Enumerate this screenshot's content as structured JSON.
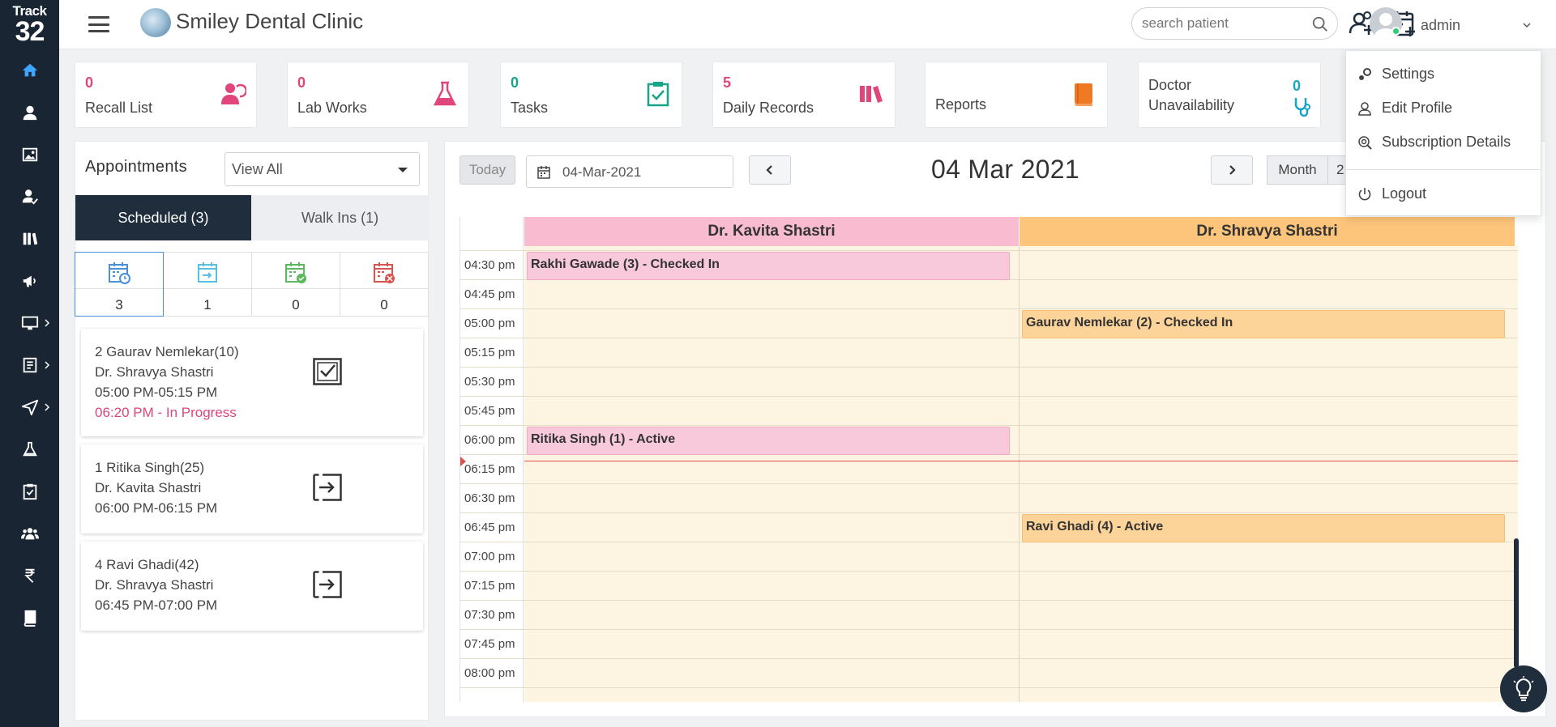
{
  "sidebar": {
    "logo_line1": "Track",
    "logo_line2": "32",
    "items": [
      {
        "icon": "home-icon"
      },
      {
        "icon": "patient-icon"
      },
      {
        "icon": "image-icon"
      },
      {
        "icon": "user-check-icon"
      },
      {
        "icon": "library-icon"
      },
      {
        "icon": "megaphone-icon"
      },
      {
        "icon": "monitor-icon",
        "has_sub": true
      },
      {
        "icon": "document-icon",
        "has_sub": true
      },
      {
        "icon": "send-icon",
        "has_sub": true
      },
      {
        "icon": "flask-icon"
      },
      {
        "icon": "clipboard-check-icon"
      },
      {
        "icon": "group-icon"
      },
      {
        "icon": "rupee-icon"
      },
      {
        "icon": "book-icon"
      }
    ]
  },
  "header": {
    "clinic_name": "Smiley Dental Clinic",
    "search_placeholder": "search patient",
    "username": "admin"
  },
  "cards": [
    {
      "count": "0",
      "label": "Recall List",
      "color": "#e0457b",
      "icon": "recall-icon"
    },
    {
      "count": "0",
      "label": "Lab Works",
      "color": "#e0457b",
      "icon": "flask-icon"
    },
    {
      "count": "0",
      "label": "Tasks",
      "color": "#17a589",
      "icon": "clipboard-check-icon"
    },
    {
      "count": "5",
      "label": "Daily Records",
      "color": "#e0457b",
      "icon": "books-icon"
    },
    {
      "label": "Reports",
      "color": "#f07a24",
      "icon": "report-book-icon"
    },
    {
      "count": "0",
      "label_line1": "Doctor",
      "label_line2": "Unavailability",
      "color": "#17a5c4",
      "icon": "stethoscope-icon"
    }
  ],
  "appointments": {
    "title": "Appointments",
    "filter_value": "View All",
    "tab_scheduled": "Scheduled (3)",
    "tab_walkins": "Walk Ins (1)",
    "stats": [
      {
        "icon": "calendar-clock-icon",
        "value": "3",
        "color": "#4a90d9"
      },
      {
        "icon": "calendar-arrow-icon",
        "value": "1",
        "color": "#5bc0de"
      },
      {
        "icon": "calendar-check-icon",
        "value": "0",
        "color": "#5cb85c"
      },
      {
        "icon": "calendar-cancel-icon",
        "value": "0",
        "color": "#d9534f"
      }
    ],
    "list": [
      {
        "name": "2 Gaurav Nemlekar(10)",
        "doctor": "Dr. Shravya Shastri",
        "time": "05:00 PM-05:15 PM",
        "status": "06:20 PM - In Progress",
        "icon": "checkbox-icon"
      },
      {
        "name": "1 Ritika Singh(25)",
        "doctor": "Dr. Kavita Shastri",
        "time": "06:00 PM-06:15 PM",
        "icon": "check-in-icon"
      },
      {
        "name": "4 Ravi Ghadi(42)",
        "doctor": "Dr. Shravya Shastri",
        "time": "06:45 PM-07:00 PM",
        "icon": "check-in-icon"
      }
    ]
  },
  "calendar": {
    "today_label": "Today",
    "date_value": "04-Mar-2021",
    "title": "04 Mar 2021",
    "view_month": "Month",
    "view_partial": "2",
    "doctors": [
      {
        "name": "Dr. Kavita Shastri",
        "color": "#f8bbd0"
      },
      {
        "name": "Dr. Shravya Shastri",
        "color": "#fdc57b"
      }
    ],
    "times": [
      "04:30 pm",
      "04:45 pm",
      "05:00 pm",
      "05:15 pm",
      "05:30 pm",
      "05:45 pm",
      "06:00 pm",
      "06:15 pm",
      "06:30 pm",
      "06:45 pm",
      "07:00 pm",
      "07:15 pm",
      "07:30 pm",
      "07:45 pm",
      "08:00 pm"
    ],
    "events": [
      {
        "text": "Rakhi Gawade (3) - Checked In",
        "doctor": 0,
        "slot": 0,
        "color": "pink"
      },
      {
        "text": "Gaurav Nemlekar (2) - Checked In",
        "doctor": 1,
        "slot": 2,
        "color": "orange"
      },
      {
        "text": "Ritika Singh (1) - Active",
        "doctor": 0,
        "slot": 6,
        "color": "pink"
      },
      {
        "text": "Ravi Ghadi (4) - Active",
        "doctor": 1,
        "slot": 9,
        "color": "orange"
      }
    ],
    "now_time": "06:17 pm"
  },
  "user_menu": {
    "settings": "Settings",
    "edit_profile": "Edit Profile",
    "subscription": "Subscription Details",
    "logout": "Logout"
  }
}
